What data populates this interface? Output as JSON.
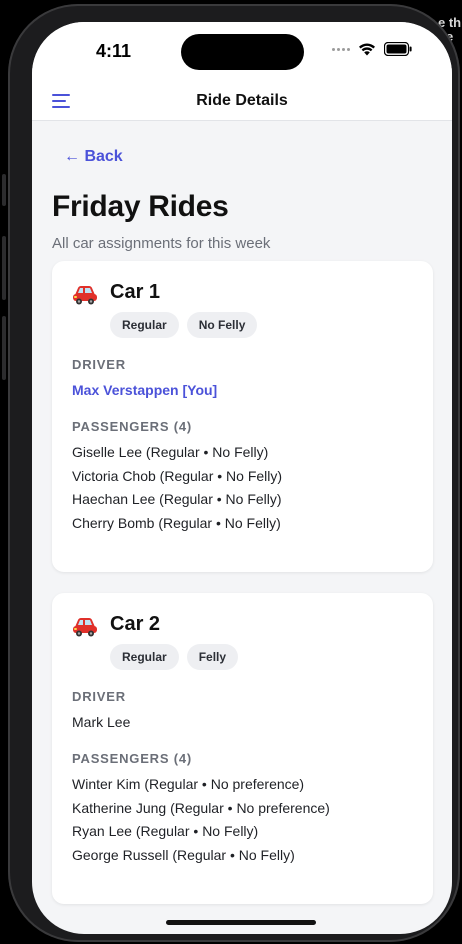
{
  "status_bar": {
    "time": "4:11"
  },
  "edge_text": "e th\npe",
  "nav": {
    "title": "Ride Details",
    "menu_icon": "hamburger-menu-icon"
  },
  "page": {
    "back_label": "← Back",
    "title": "Friday Rides",
    "subtitle": "All car assignments for this week"
  },
  "cars": [
    {
      "name": "Car 1",
      "tags": [
        "Regular",
        "No Felly"
      ],
      "driver_label": "DRIVER",
      "driver": "Max Verstappen [You]",
      "driver_is_you": true,
      "passengers_label": "PASSENGERS (4)",
      "passengers": [
        "Giselle Lee (Regular • No Felly)",
        "Victoria Chob (Regular • No Felly)",
        "Haechan Lee (Regular • No Felly)",
        "Cherry Bomb (Regular • No Felly)"
      ]
    },
    {
      "name": "Car 2",
      "tags": [
        "Regular",
        "Felly"
      ],
      "driver_label": "DRIVER",
      "driver": "Mark Lee",
      "driver_is_you": false,
      "passengers_label": "PASSENGERS (4)",
      "passengers": [
        "Winter Kim (Regular • No preference)",
        "Katherine Jung (Regular • No preference)",
        "Ryan Lee (Regular • No Felly)",
        "George Russell (Regular • No Felly)"
      ]
    }
  ],
  "colors": {
    "accent": "#4b52d9",
    "background": "#f4f5f7",
    "card": "#ffffff",
    "tag": "#eeeff2",
    "car_emoji": "#e0302a"
  }
}
